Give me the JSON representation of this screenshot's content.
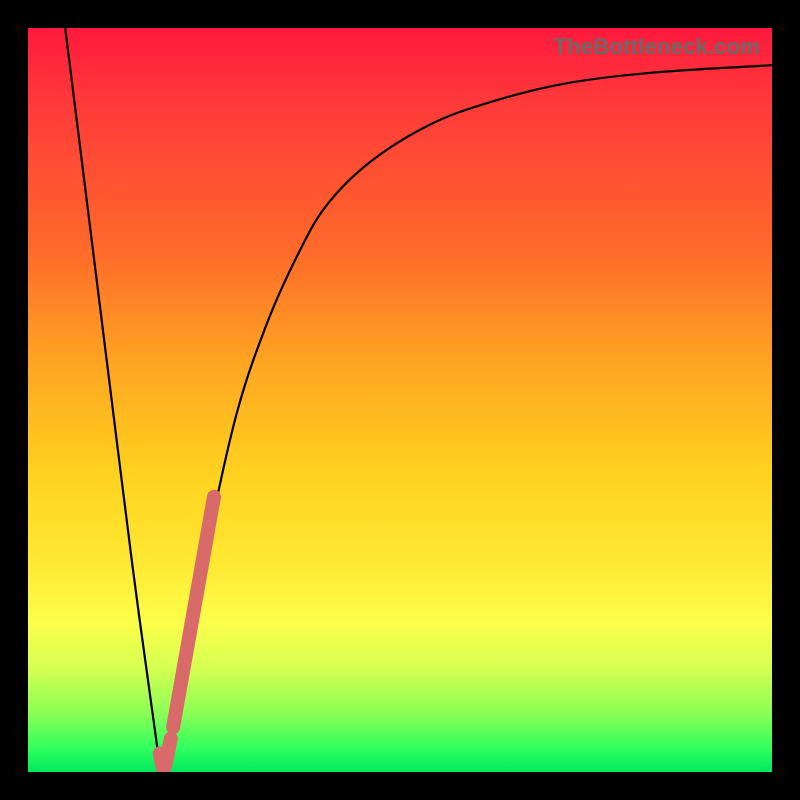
{
  "watermark": "TheBottleneck.com",
  "colors": {
    "frame": "#000000",
    "gradient_top": "#ff1a3d",
    "gradient_bottom": "#00e85e",
    "curve": "#000000",
    "highlight": "#d96a6a"
  },
  "chart_data": {
    "type": "line",
    "title": "",
    "xlabel": "",
    "ylabel": "",
    "xlim": [
      0,
      100
    ],
    "ylim": [
      0,
      100
    ],
    "grid": false,
    "legend": false,
    "series": [
      {
        "name": "bottleneck-curve",
        "x": [
          5,
          8,
          11,
          14,
          17,
          18,
          19,
          20,
          24,
          28,
          32,
          36,
          40,
          46,
          54,
          62,
          72,
          84,
          100
        ],
        "y": [
          100,
          76,
          52,
          28,
          6,
          0,
          2,
          8,
          30,
          48,
          60,
          69,
          76,
          82,
          87,
          90,
          92.5,
          94,
          95
        ]
      },
      {
        "name": "highlight-segment",
        "x": [
          19.5,
          25.0
        ],
        "y": [
          6,
          37
        ]
      },
      {
        "name": "hook-at-min",
        "x": [
          17.7,
          18.3,
          19.2
        ],
        "y": [
          2.5,
          0.5,
          4.5
        ]
      }
    ],
    "annotations": []
  }
}
